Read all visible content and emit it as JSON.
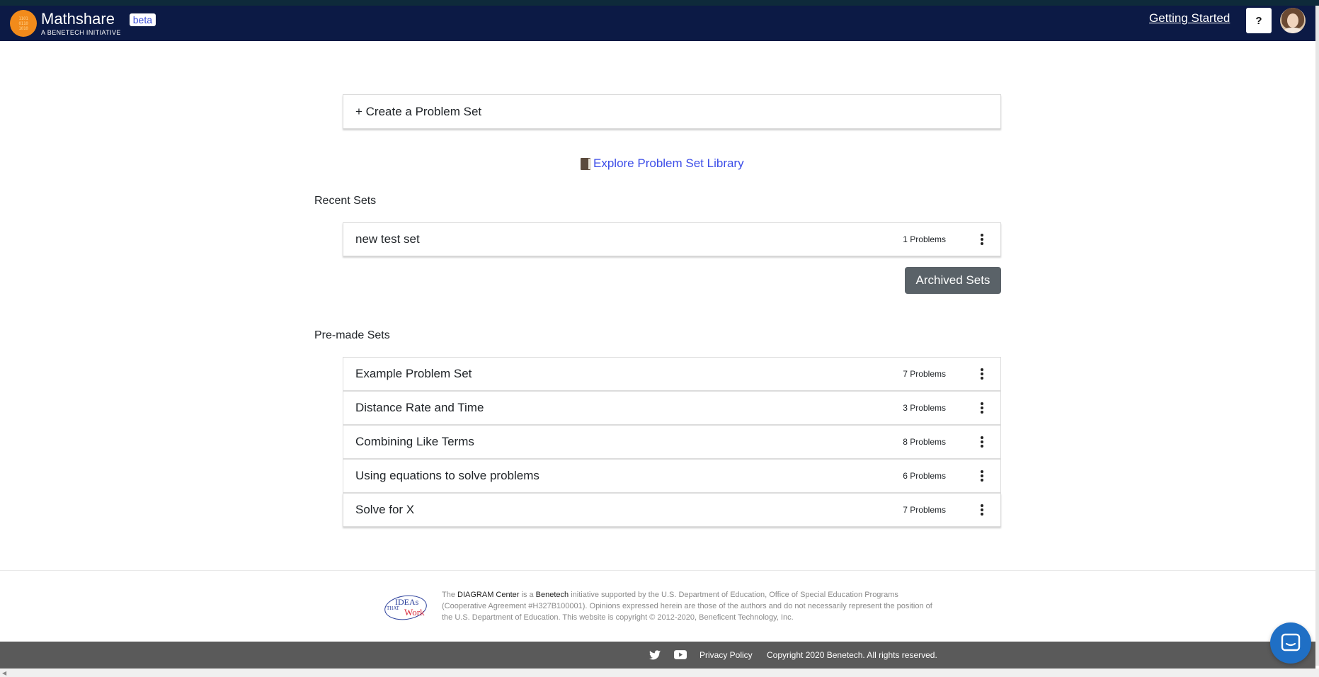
{
  "header": {
    "app_name": "Mathshare",
    "app_sub": "A BENETECH INITIATIVE",
    "beta_label": "beta",
    "getting_started": "Getting Started",
    "help_label": "?"
  },
  "main": {
    "create_label": "+ Create a Problem Set",
    "explore_label": "Explore Problem Set Library",
    "recent_title": "Recent Sets",
    "recent_sets": [
      {
        "title": "new test set",
        "count": "1 Problems"
      }
    ],
    "archived_label": "Archived Sets",
    "premade_title": "Pre-made Sets",
    "premade_sets": [
      {
        "title": "Example Problem Set",
        "count": "7 Problems"
      },
      {
        "title": "Distance Rate and Time",
        "count": "3 Problems"
      },
      {
        "title": "Combining Like Terms",
        "count": "8 Problems"
      },
      {
        "title": "Using equations to solve problems",
        "count": "6 Problems"
      },
      {
        "title": "Solve for X",
        "count": "7 Problems"
      }
    ]
  },
  "footer": {
    "logo_text_1": "IDEAs",
    "logo_text_2": "THAT",
    "logo_text_3": "Work",
    "text_the": "The ",
    "diagram_center": "DIAGRAM Center",
    "text_is_a": " is a ",
    "benetech": "Benetech",
    "text_rest": " initiative supported by the U.S. Department of Education, Office of Special Education Programs (Cooperative Agreement #H327B100001). Opinions expressed herein are those of the authors and do not necessarily represent the position of the U.S. Department of Education. This website is copyright © 2012-2020, Beneficent Technology, Inc.",
    "privacy": "Privacy Policy",
    "copyright": "Copyright 2020 Benetech. All rights reserved."
  },
  "colors": {
    "header_bg": "#0c1a45",
    "link": "#3d4ee8",
    "archived_btn": "#5a6268",
    "bottom_bar": "#5a5a5a",
    "chat_btn": "#1f6fc5"
  }
}
